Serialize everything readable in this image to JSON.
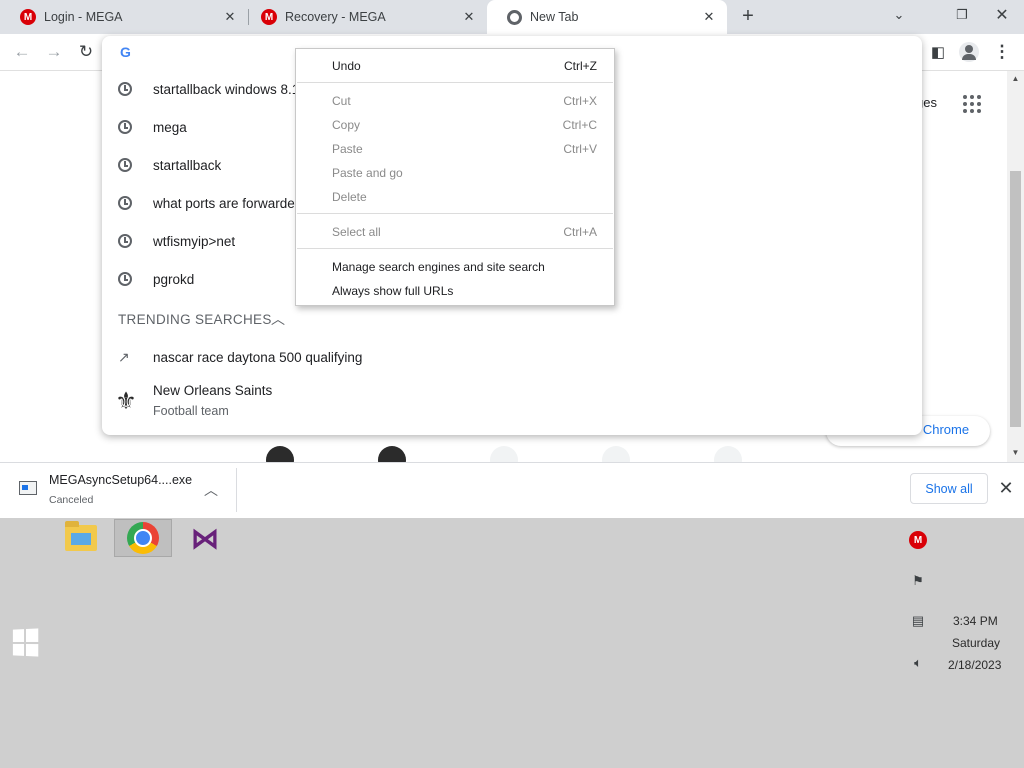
{
  "browser": {
    "tabs": [
      {
        "label": "Login - MEGA",
        "favicon": "mega-icon"
      },
      {
        "label": "Recovery - MEGA",
        "favicon": "mega-icon"
      },
      {
        "label": "New Tab",
        "favicon": "chrome-icon",
        "active": true
      }
    ],
    "new_tab_symbol": "+",
    "close_symbol": "✕"
  },
  "omnibox": {
    "logo": "G",
    "suggestions": [
      {
        "text": "startallback windows 8.1",
        "icon": "history-clock-icon"
      },
      {
        "text": "mega",
        "icon": "history-clock-icon"
      },
      {
        "text": "startallback",
        "icon": "history-clock-icon"
      },
      {
        "text": "what ports are forwarded",
        "icon": "history-clock-icon"
      },
      {
        "text": "wtfismyip>net",
        "icon": "history-clock-icon"
      },
      {
        "text": "pgrokd",
        "icon": "history-clock-icon"
      }
    ],
    "trending_header": "TRENDING SEARCHES",
    "trending": [
      {
        "text": "nascar race daytona 500 qualifying",
        "icon": "trending-arrow-icon"
      }
    ],
    "entity": {
      "title": "New Orleans Saints",
      "subtitle": "Football team",
      "icon": "fleur-de-lis-icon"
    }
  },
  "context_menu": {
    "items": [
      {
        "label": "Undo",
        "shortcut": "Ctrl+Z",
        "enabled": true
      },
      {
        "label": "Cut",
        "shortcut": "Ctrl+X",
        "enabled": false
      },
      {
        "label": "Copy",
        "shortcut": "Ctrl+C",
        "enabled": false
      },
      {
        "label": "Paste",
        "shortcut": "Ctrl+V",
        "enabled": false
      },
      {
        "label": "Paste and go",
        "shortcut": "",
        "enabled": false
      },
      {
        "label": "Delete",
        "shortcut": "",
        "enabled": false
      },
      {
        "label": "Select all",
        "shortcut": "Ctrl+A",
        "enabled": false
      },
      {
        "label": "Manage search engines and site search",
        "shortcut": "",
        "enabled": true
      },
      {
        "label": "Always show full URLs",
        "shortcut": "",
        "enabled": true
      }
    ]
  },
  "newtab_page": {
    "images_link": "ges",
    "customize_label": "e Chrome"
  },
  "download_bar": {
    "filename": "MEGAsyncSetup64....exe",
    "status": "Canceled",
    "show_all": "Show all"
  },
  "taskbar": {
    "apps": [
      "file-explorer-icon",
      "chrome-icon",
      "visual-studio-icon"
    ],
    "clock": {
      "time": "3:34 PM",
      "day": "Saturday",
      "date": "2/18/2023"
    }
  },
  "colors": {
    "accent": "#1a73e8",
    "mega_red": "#d90007",
    "tab_strip": "#dee1e6",
    "desktop": "#cfcfcf"
  }
}
